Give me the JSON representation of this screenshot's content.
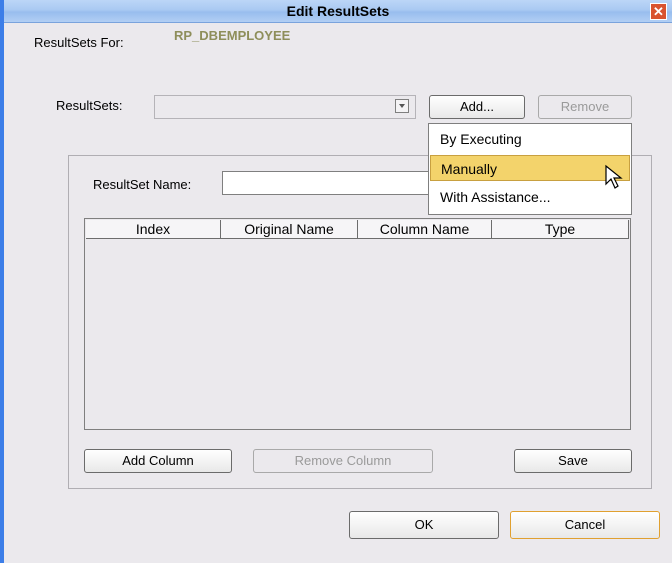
{
  "dialog": {
    "title": "Edit ResultSets"
  },
  "header": {
    "for_label": "ResultSets For:",
    "for_value": "RP_DBEMPLOYEE",
    "resultsets_label": "ResultSets:",
    "resultsets_value": "",
    "add_label": "Add...",
    "remove_label": "Remove"
  },
  "add_menu": {
    "items": [
      {
        "label": "By Executing",
        "selected": false
      },
      {
        "label": "Manually",
        "selected": true
      },
      {
        "label": "With Assistance...",
        "selected": false
      }
    ]
  },
  "panel": {
    "name_label": "ResultSet Name:",
    "name_value": "",
    "columns": [
      "Index",
      "Original Name",
      "Column Name",
      "Type"
    ],
    "rows": [],
    "add_column_label": "Add Column",
    "remove_column_label": "Remove Column",
    "save_label": "Save"
  },
  "footer": {
    "ok_label": "OK",
    "cancel_label": "Cancel"
  },
  "icons": {
    "close": "close-icon",
    "dropdown": "chevron-down-icon",
    "cursor": "mouse-pointer-icon"
  },
  "colors": {
    "dialog_bg": "#ebe9ed",
    "title_bar": "#a9c9f2",
    "window_border": "#3c7ee8",
    "highlight": "#f3d36b",
    "value_text": "#8e8e5a"
  }
}
